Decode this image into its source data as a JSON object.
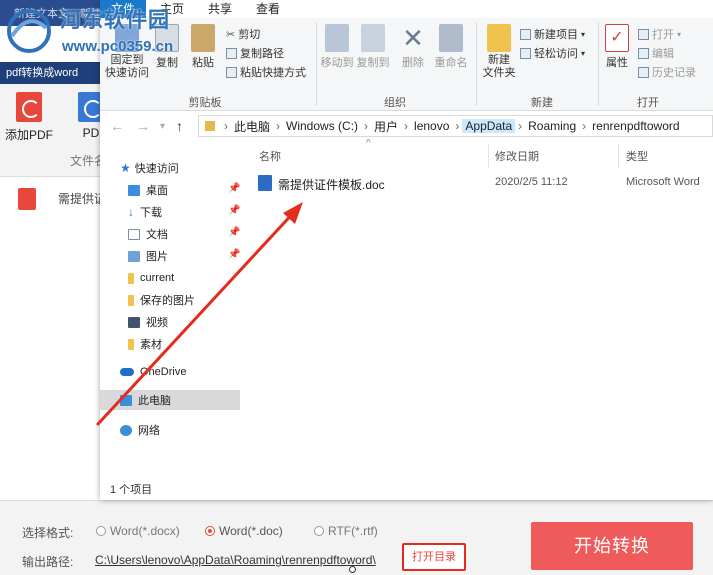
{
  "bg_app": {
    "titlebar_fragments": [
      "新建文本文",
      "新建"
    ],
    "title": "pdf转换成word",
    "tools": [
      {
        "label": "添加PDF",
        "icon": "pdf-icon"
      },
      {
        "label": "PD",
        "icon": "pdf-icon"
      }
    ],
    "section_label": "文件名",
    "file_name": "需提供证",
    "format_label": "选择格式:",
    "formats": [
      {
        "label": "Word(*.docx)",
        "selected": false
      },
      {
        "label": "Word(*.doc)",
        "selected": true
      },
      {
        "label": "RTF(*.rtf)",
        "selected": false
      }
    ],
    "output_label": "输出路径:",
    "output_path": "C:\\Users\\lenovo\\AppData\\Roaming\\renrenpdftoword\\",
    "open_dir": "打开目录",
    "start": "开始转换",
    "accent": "#ef5a5a"
  },
  "watermark": {
    "text": "河东软件园",
    "url": "www.pc0359.cn"
  },
  "explorer": {
    "tabs": [
      "文件",
      "主页",
      "共享",
      "查看"
    ],
    "ribbon": {
      "clipboard": {
        "pin": "固定到\n快速访问",
        "copy": "复制",
        "paste": "粘贴",
        "cut": "剪切",
        "copy_path": "复制路径",
        "paste_shortcut": "粘贴快捷方式",
        "label": "剪贴板"
      },
      "organize": {
        "move_to": "移动到",
        "copy_to": "复制到",
        "delete": "删除",
        "rename": "重命名",
        "label": "组织"
      },
      "new": {
        "new_folder": "新建\n文件夹",
        "new_item": "新建项目",
        "easy_access": "轻松访问",
        "label": "新建"
      },
      "open": {
        "properties": "属性",
        "open": "打开",
        "edit": "编辑",
        "history": "历史记录",
        "label": "打开"
      }
    },
    "breadcrumb": [
      "此电脑",
      "Windows (C:)",
      "用户",
      "lenovo",
      "AppData",
      "Roaming",
      "renrenpdftoword"
    ],
    "nav": [
      {
        "label": "快速访问",
        "icon": "star-icon",
        "pinned": false
      },
      {
        "label": "桌面",
        "icon": "desktop-icon",
        "pinned": true
      },
      {
        "label": "下载",
        "icon": "download-icon",
        "pinned": true
      },
      {
        "label": "文档",
        "icon": "document-icon",
        "pinned": true
      },
      {
        "label": "图片",
        "icon": "picture-icon",
        "pinned": true
      },
      {
        "label": "current",
        "icon": "folder-icon",
        "pinned": false
      },
      {
        "label": "保存的图片",
        "icon": "folder-icon",
        "pinned": false
      },
      {
        "label": "视频",
        "icon": "video-icon",
        "pinned": false
      },
      {
        "label": "素材",
        "icon": "folder-icon",
        "pinned": false
      },
      {
        "label": "OneDrive",
        "icon": "cloud-icon",
        "pinned": false
      },
      {
        "label": "此电脑",
        "icon": "computer-icon",
        "pinned": false
      },
      {
        "label": "网络",
        "icon": "network-icon",
        "pinned": false
      }
    ],
    "columns": [
      "名称",
      "修改日期",
      "类型"
    ],
    "files": [
      {
        "name": "需提供证件模板.doc",
        "date": "2020/2/5 11:12",
        "type": "Microsoft Word"
      }
    ],
    "status": "1 个项目"
  }
}
